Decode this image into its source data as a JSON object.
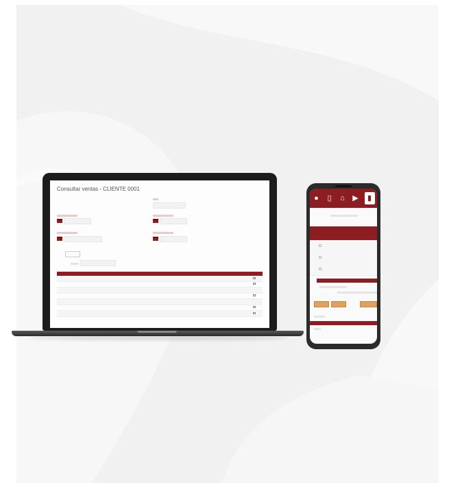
{
  "colors": {
    "brand": "#8c1e22",
    "background": "#f1f1f1",
    "device": "#1c1c1c",
    "accent_button": "#e0a060"
  },
  "laptop": {
    "title": "Consultar ventas - CLIENTE 0001",
    "icons": [
      "calendar-icon",
      "printer-icon"
    ]
  },
  "phone": {
    "nav_icons": [
      "user-icon",
      "document-icon",
      "home-icon",
      "truck-icon",
      "file-icon"
    ]
  }
}
